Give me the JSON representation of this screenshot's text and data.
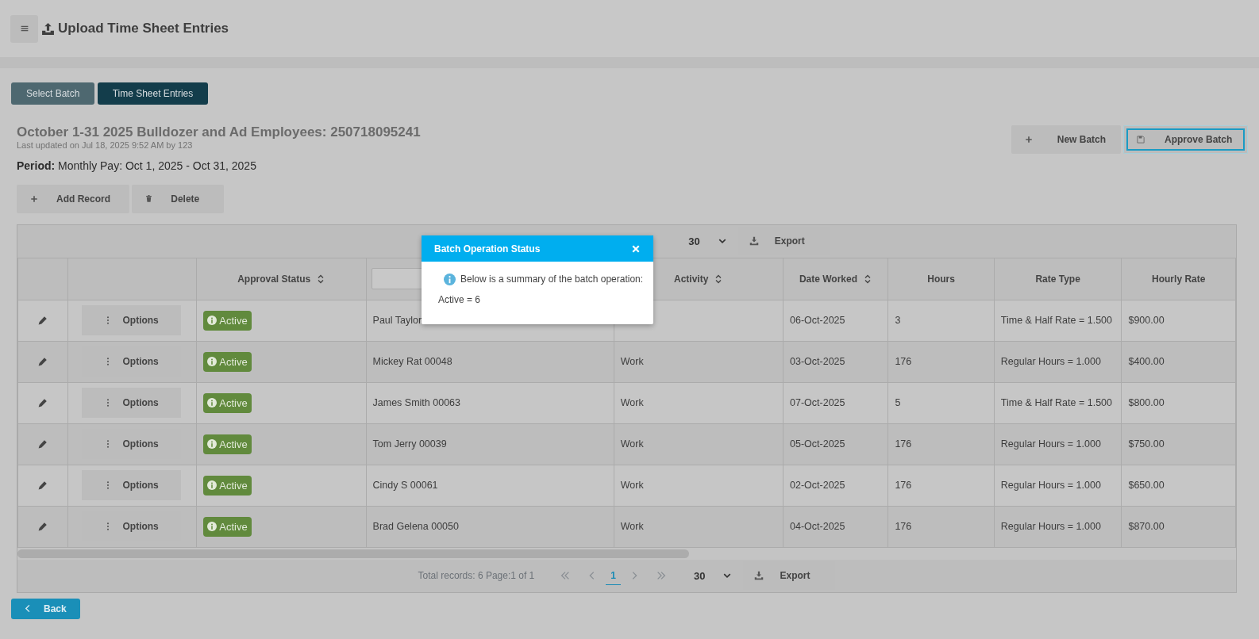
{
  "header": {
    "title": "Upload Time Sheet Entries"
  },
  "tabs": [
    {
      "label": "Select Batch",
      "selected": false
    },
    {
      "label": "Time Sheet Entries",
      "selected": true
    }
  ],
  "batch": {
    "title": "October 1-31 2025 Bulldozer and Ad Employees: 250718095241",
    "updated": "Last updated on Jul 18, 2025 9:52 AM by 123",
    "period": "**Period:** Monthly Pay: Oct 1, 2025 - Oct 31, 2025"
  },
  "batch_actions": [
    {
      "label": "New Batch",
      "focused": false
    },
    {
      "label": "Approve Batch",
      "focused": true
    }
  ],
  "record_actions": [
    {
      "label": "Add Record"
    },
    {
      "label": "Delete"
    }
  ],
  "top_pager": {
    "page_size": "30",
    "export": "Export"
  },
  "table": {
    "columns": [
      {
        "kind": "blank"
      },
      {
        "kind": "blank"
      },
      {
        "kind": "sort",
        "label": "Approval Status"
      },
      {
        "kind": "filter"
      },
      {
        "kind": "sort",
        "label": "Activity"
      },
      {
        "kind": "sort",
        "label": "Date Worked"
      },
      {
        "kind": "plain",
        "label": "Hours"
      },
      {
        "kind": "plain",
        "label": "Rate Type"
      },
      {
        "kind": "plain",
        "label": "Hourly Rate"
      }
    ],
    "rows": [
      {
        "options": "Options",
        "status": "Active",
        "employee": "Paul Taylor",
        "date": "06-Oct-2025",
        "hours": "3",
        "rate_type": "Time & Half Rate = 1.500",
        "hourly_rate": "$900.00"
      },
      {
        "options": "Options",
        "status": "Active",
        "employee": "Mickey Rat 00048",
        "activity": "Work",
        "date": "03-Oct-2025",
        "hours": "176",
        "rate_type": "Regular Hours = 1.000",
        "hourly_rate": "$400.00"
      },
      {
        "options": "Options",
        "status": "Active",
        "employee": "James Smith 00063",
        "activity": "Work",
        "date": "07-Oct-2025",
        "hours": "5",
        "rate_type": "Time & Half Rate = 1.500",
        "hourly_rate": "$800.00"
      },
      {
        "options": "Options",
        "status": "Active",
        "employee": "Tom Jerry 00039",
        "activity": "Work",
        "date": "05-Oct-2025",
        "hours": "176",
        "rate_type": "Regular Hours = 1.000",
        "hourly_rate": "$750.00"
      },
      {
        "options": "Options",
        "status": "Active",
        "employee": "Cindy S 00061",
        "activity": "Work",
        "date": "02-Oct-2025",
        "hours": "176",
        "rate_type": "Regular Hours = 1.000",
        "hourly_rate": "$650.00"
      },
      {
        "options": "Options",
        "status": "Active",
        "employee": "Brad Gelena 00050",
        "activity": "Work",
        "date": "04-Oct-2025",
        "hours": "176",
        "rate_type": "Regular Hours = 1.000",
        "hourly_rate": "$870.00"
      }
    ]
  },
  "bottom_pager": {
    "summary": "Total records: 6 Page:1 of 1",
    "pages": [
      {
        "label": "1",
        "selected": true
      }
    ],
    "page_size": "30",
    "export": "Export"
  },
  "modal": {
    "title": "Batch Operation Status",
    "message": "Below is a summary of the batch operation:",
    "result": "Active = 6"
  },
  "back": {
    "label": "Back"
  }
}
